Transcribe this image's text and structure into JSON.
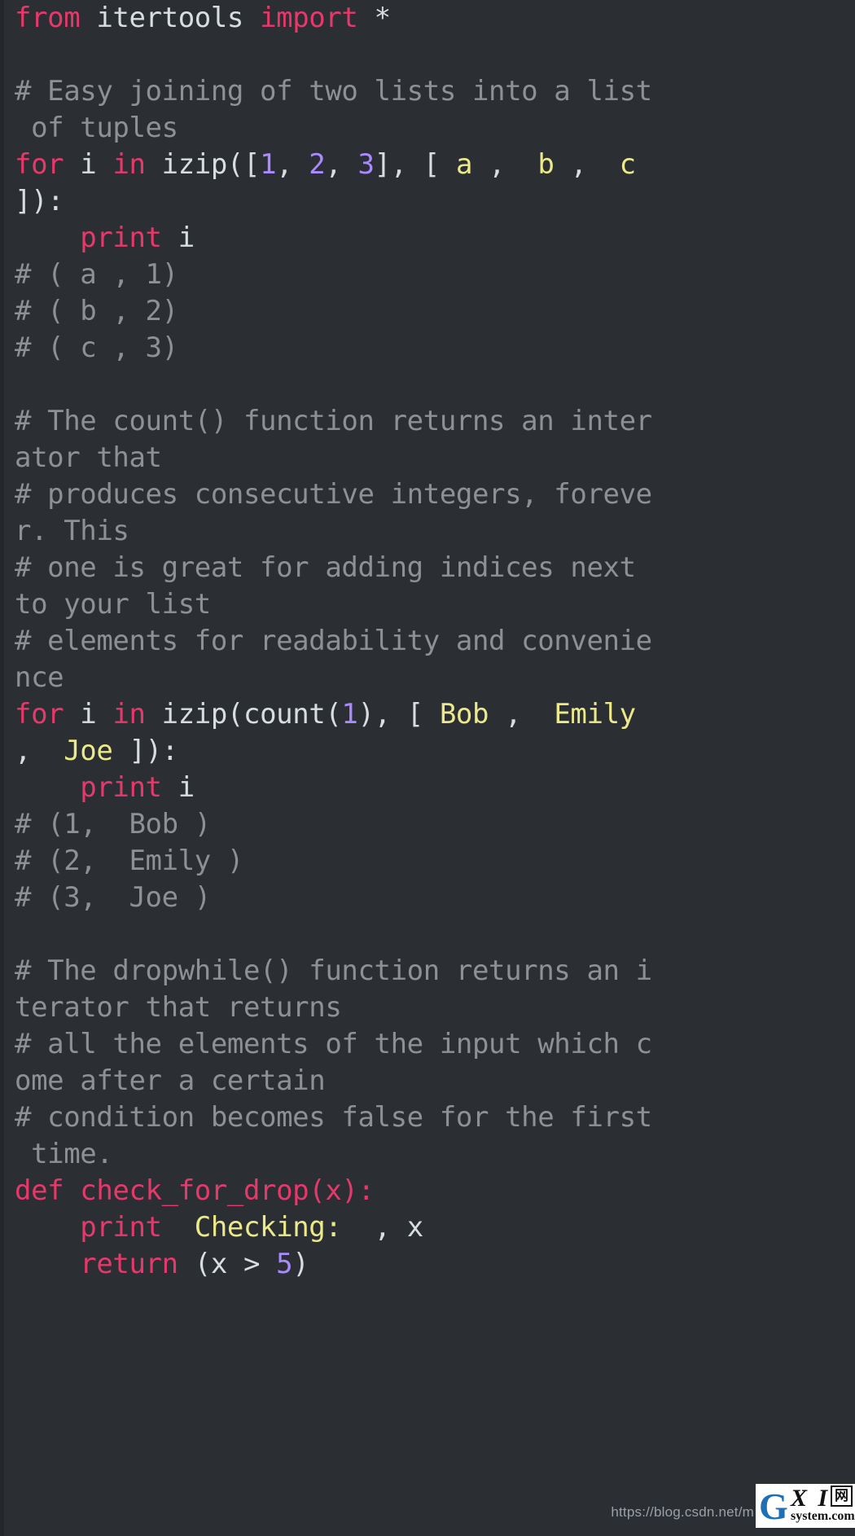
{
  "page": {
    "kind": "code-screenshot",
    "language": "Python",
    "theme": "dark",
    "background_color": "#2b2f33",
    "gutter_color": "#25282b"
  },
  "colors": {
    "keyword": "#e6396b",
    "plain": "#d8dde1",
    "number": "#a98aff",
    "string": "#ece98a",
    "comment": "#8d9195"
  },
  "code": {
    "lines": [
      {
        "tokens": [
          {
            "t": "from",
            "c": "kw"
          },
          {
            "t": " ",
            "c": "plain"
          },
          {
            "t": "itertools",
            "c": "plain"
          },
          {
            "t": " ",
            "c": "plain"
          },
          {
            "t": "import",
            "c": "kw"
          },
          {
            "t": " *",
            "c": "plain"
          }
        ]
      },
      {
        "tokens": [
          {
            "t": "",
            "c": "plain"
          }
        ]
      },
      {
        "tokens": [
          {
            "t": "# Easy joining of two lists into a list",
            "c": "comment"
          }
        ]
      },
      {
        "tokens": [
          {
            "t": " of tuples",
            "c": "comment"
          }
        ]
      },
      {
        "tokens": [
          {
            "t": "for",
            "c": "kw"
          },
          {
            "t": " i ",
            "c": "plain"
          },
          {
            "t": "in",
            "c": "kw"
          },
          {
            "t": " izip([",
            "c": "plain"
          },
          {
            "t": "1",
            "c": "num"
          },
          {
            "t": ", ",
            "c": "plain"
          },
          {
            "t": "2",
            "c": "num"
          },
          {
            "t": ", ",
            "c": "plain"
          },
          {
            "t": "3",
            "c": "num"
          },
          {
            "t": "], [ ",
            "c": "plain"
          },
          {
            "t": "a",
            "c": "str"
          },
          {
            "t": " ,  ",
            "c": "plain"
          },
          {
            "t": "b",
            "c": "str"
          },
          {
            "t": " ,  ",
            "c": "plain"
          },
          {
            "t": "c",
            "c": "str"
          }
        ]
      },
      {
        "tokens": [
          {
            "t": "]):",
            "c": "plain"
          }
        ]
      },
      {
        "tokens": [
          {
            "t": "    ",
            "c": "plain"
          },
          {
            "t": "print",
            "c": "kw"
          },
          {
            "t": " i",
            "c": "plain"
          }
        ]
      },
      {
        "tokens": [
          {
            "t": "# ( a , 1)",
            "c": "comment"
          }
        ]
      },
      {
        "tokens": [
          {
            "t": "# ( b , 2)",
            "c": "comment"
          }
        ]
      },
      {
        "tokens": [
          {
            "t": "# ( c , 3)",
            "c": "comment"
          }
        ]
      },
      {
        "tokens": [
          {
            "t": "",
            "c": "plain"
          }
        ]
      },
      {
        "tokens": [
          {
            "t": "# The count() function returns an inter",
            "c": "comment"
          }
        ]
      },
      {
        "tokens": [
          {
            "t": "ator that",
            "c": "comment"
          }
        ]
      },
      {
        "tokens": [
          {
            "t": "# produces consecutive integers, foreve",
            "c": "comment"
          }
        ]
      },
      {
        "tokens": [
          {
            "t": "r. This",
            "c": "comment"
          }
        ]
      },
      {
        "tokens": [
          {
            "t": "# one is great for adding indices next",
            "c": "comment"
          }
        ]
      },
      {
        "tokens": [
          {
            "t": "to your list",
            "c": "comment"
          }
        ]
      },
      {
        "tokens": [
          {
            "t": "# elements for readability and convenie",
            "c": "comment"
          }
        ]
      },
      {
        "tokens": [
          {
            "t": "nce",
            "c": "comment"
          }
        ]
      },
      {
        "tokens": [
          {
            "t": "for",
            "c": "kw"
          },
          {
            "t": " i ",
            "c": "plain"
          },
          {
            "t": "in",
            "c": "kw"
          },
          {
            "t": " izip(count(",
            "c": "plain"
          },
          {
            "t": "1",
            "c": "num"
          },
          {
            "t": "), [ ",
            "c": "plain"
          },
          {
            "t": "Bob",
            "c": "str"
          },
          {
            "t": " ,  ",
            "c": "plain"
          },
          {
            "t": "Emily",
            "c": "str"
          }
        ]
      },
      {
        "tokens": [
          {
            "t": ",  ",
            "c": "plain"
          },
          {
            "t": "Joe",
            "c": "str"
          },
          {
            "t": " ]):",
            "c": "plain"
          }
        ]
      },
      {
        "tokens": [
          {
            "t": "    ",
            "c": "plain"
          },
          {
            "t": "print",
            "c": "kw"
          },
          {
            "t": " i",
            "c": "plain"
          }
        ]
      },
      {
        "tokens": [
          {
            "t": "# (1,  Bob )",
            "c": "comment"
          }
        ]
      },
      {
        "tokens": [
          {
            "t": "# (2,  Emily )",
            "c": "comment"
          }
        ]
      },
      {
        "tokens": [
          {
            "t": "# (3,  Joe )",
            "c": "comment"
          }
        ]
      },
      {
        "tokens": [
          {
            "t": "",
            "c": "plain"
          }
        ]
      },
      {
        "tokens": [
          {
            "t": "# The dropwhile() function returns an i",
            "c": "comment"
          }
        ]
      },
      {
        "tokens": [
          {
            "t": "terator that returns",
            "c": "comment"
          }
        ]
      },
      {
        "tokens": [
          {
            "t": "# all the elements of the input which c",
            "c": "comment"
          }
        ]
      },
      {
        "tokens": [
          {
            "t": "ome after a certain",
            "c": "comment"
          }
        ]
      },
      {
        "tokens": [
          {
            "t": "# condition becomes false for the first",
            "c": "comment"
          }
        ]
      },
      {
        "tokens": [
          {
            "t": " time.",
            "c": "comment"
          }
        ]
      },
      {
        "tokens": [
          {
            "t": "def check_for_drop(x):",
            "c": "kw"
          }
        ]
      },
      {
        "tokens": [
          {
            "t": "    ",
            "c": "plain"
          },
          {
            "t": "print",
            "c": "kw"
          },
          {
            "t": "  ",
            "c": "plain"
          },
          {
            "t": "Checking:",
            "c": "str"
          },
          {
            "t": "  , x",
            "c": "plain"
          }
        ]
      },
      {
        "tokens": [
          {
            "t": "    ",
            "c": "plain"
          },
          {
            "t": "return",
            "c": "kw"
          },
          {
            "t": " (x > ",
            "c": "plain"
          },
          {
            "t": "5",
            "c": "num"
          },
          {
            "t": ")",
            "c": "plain"
          }
        ]
      }
    ]
  },
  "watermark": {
    "url_text": "https://blog.csdn.net/m",
    "logo_letter": "G",
    "logo_xi": "X I",
    "logo_wang": "网",
    "logo_domain": "system.com"
  }
}
